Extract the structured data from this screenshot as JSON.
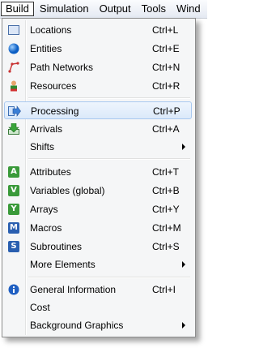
{
  "menubar": {
    "items": [
      "Build",
      "Simulation",
      "Output",
      "Tools",
      "Wind"
    ]
  },
  "menu": {
    "items": [
      {
        "label": "Locations",
        "shortcut": "Ctrl+L",
        "icon": "locations-icon"
      },
      {
        "label": "Entities",
        "shortcut": "Ctrl+E",
        "icon": "entities-icon"
      },
      {
        "label": "Path Networks",
        "shortcut": "Ctrl+N",
        "icon": "path-networks-icon"
      },
      {
        "label": "Resources",
        "shortcut": "Ctrl+R",
        "icon": "resources-icon"
      },
      {
        "label": "Processing",
        "shortcut": "Ctrl+P",
        "icon": "processing-icon"
      },
      {
        "label": "Arrivals",
        "shortcut": "Ctrl+A",
        "icon": "arrivals-icon"
      },
      {
        "label": "Shifts",
        "shortcut": "",
        "icon": ""
      },
      {
        "label": "Attributes",
        "shortcut": "Ctrl+T",
        "icon": "attributes-icon",
        "letter": "A"
      },
      {
        "label": "Variables (global)",
        "shortcut": "Ctrl+B",
        "icon": "variables-icon",
        "letter": "V"
      },
      {
        "label": "Arrays",
        "shortcut": "Ctrl+Y",
        "icon": "arrays-icon",
        "letter": "Y"
      },
      {
        "label": "Macros",
        "shortcut": "Ctrl+M",
        "icon": "macros-icon",
        "letter": "M"
      },
      {
        "label": "Subroutines",
        "shortcut": "Ctrl+S",
        "icon": "subroutines-icon",
        "letter": "S"
      },
      {
        "label": "More Elements",
        "shortcut": "",
        "icon": ""
      },
      {
        "label": "General Information",
        "shortcut": "Ctrl+I",
        "icon": "info-icon"
      },
      {
        "label": "Cost",
        "shortcut": "",
        "icon": ""
      },
      {
        "label": "Background Graphics",
        "shortcut": "",
        "icon": ""
      }
    ]
  },
  "colors": {
    "highlight": "#dbe9fa",
    "green_icon": "#3a9a3a",
    "blue_icon": "#2a5fb0"
  }
}
